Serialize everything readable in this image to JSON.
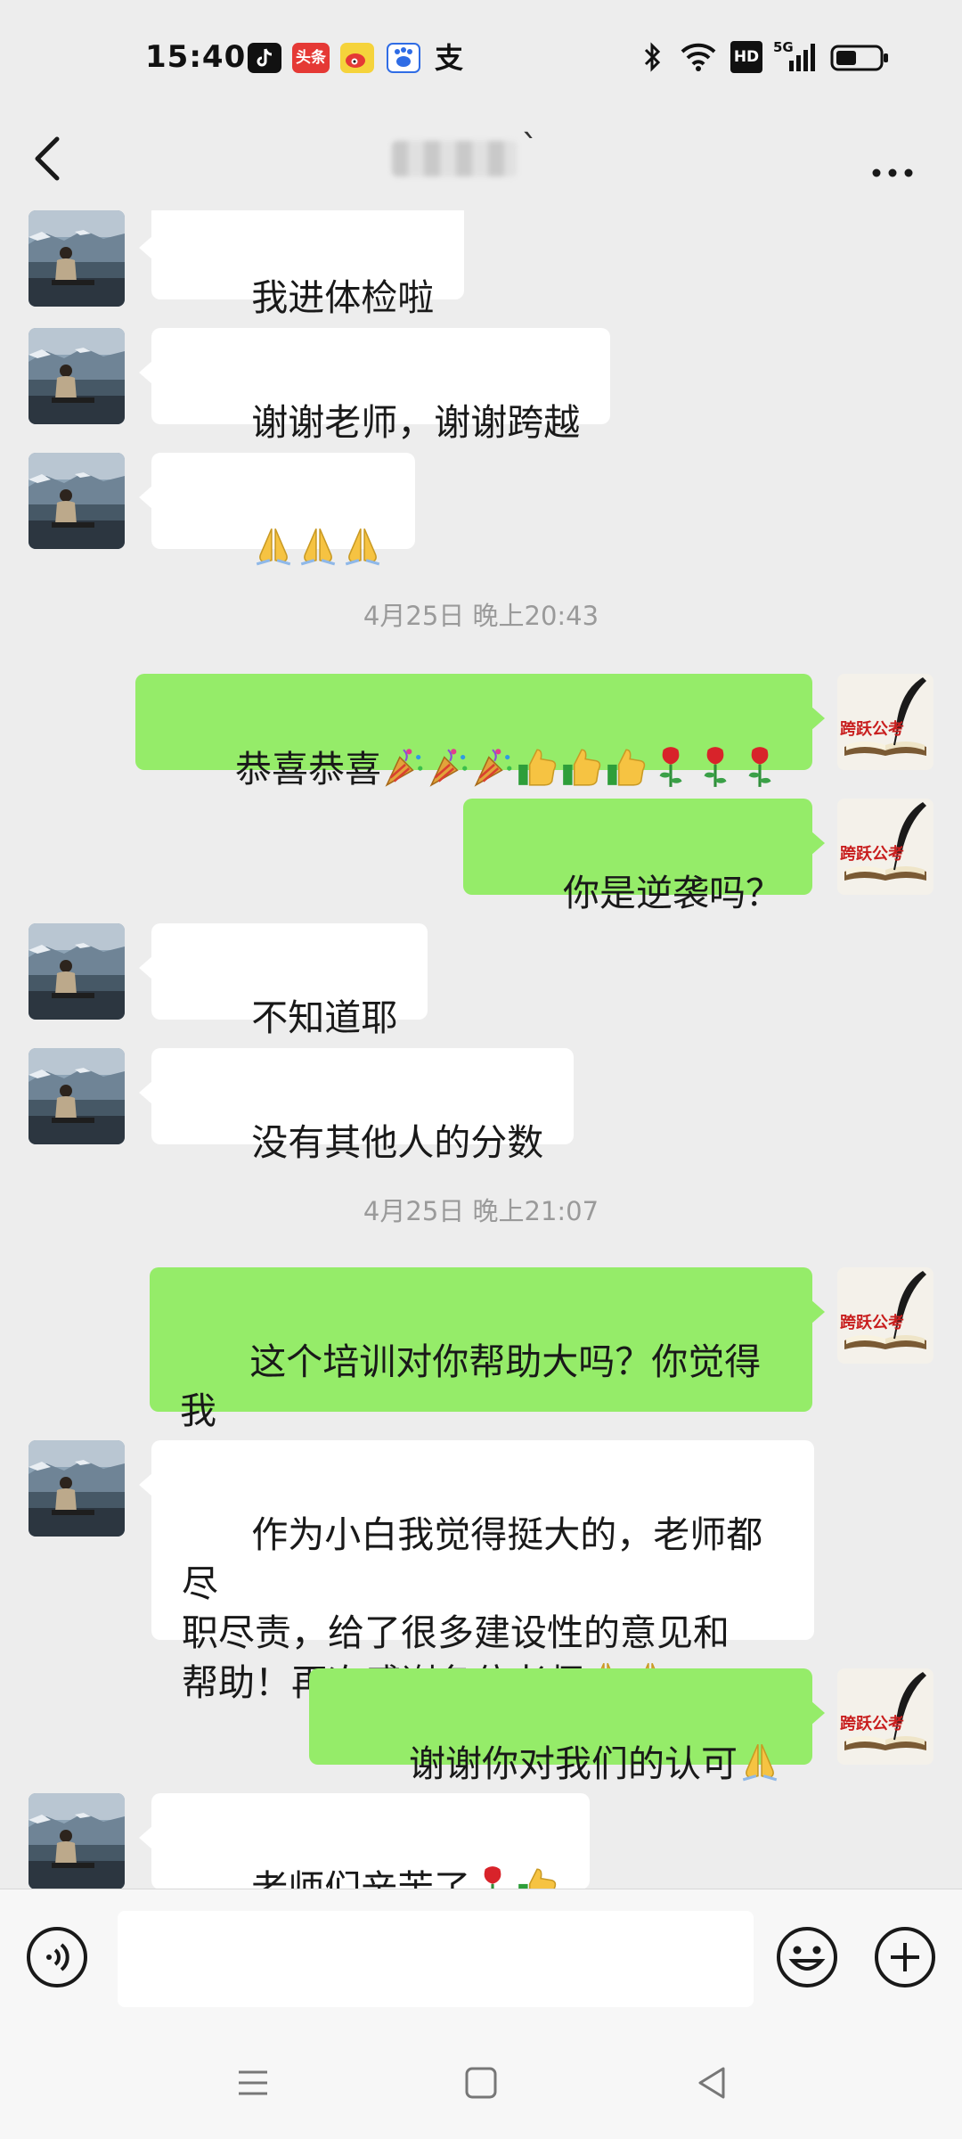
{
  "status_bar": {
    "time": "15:40",
    "apps": [
      "tiktok-icon",
      "toutiao-icon",
      "weibo-icon",
      "baidu-icon",
      "alipay-icon"
    ],
    "toutiao_label": "头条",
    "alipay_label": "支",
    "right_icons": [
      "bluetooth-icon",
      "wifi-icon",
      "hd-icon",
      "signal-5g-icon",
      "battery-icon"
    ],
    "hd_label": "HD",
    "network_label": "5G"
  },
  "header": {
    "title_tail": "`"
  },
  "chat": {
    "timestamp_1": "4月25日 晚上20:43",
    "timestamp_2": "4月25日 晚上21:07",
    "m1": "我进体检啦",
    "m2": "谢谢老师，谢谢跨越",
    "m4": "恭喜恭喜",
    "m5": "你是逆袭吗？",
    "m6": "不知道耶",
    "m7": "没有其他人的分数",
    "m8": "这个培训对你帮助大吗？你觉得我\n们的老师怎样？",
    "m9": "作为小白我觉得挺大的，老师都尽\n职尽责，给了很多建设性的意见和\n帮助！再次感谢各位老师",
    "m10": "谢谢你对我们的认可",
    "m11": "老师们辛苦了",
    "brand_avatar_label": "跨跃公考"
  },
  "colors": {
    "background": "#ededed",
    "bubble_self": "#95ec69",
    "bubble_other": "#ffffff",
    "timestamp": "#9a9a9a"
  }
}
